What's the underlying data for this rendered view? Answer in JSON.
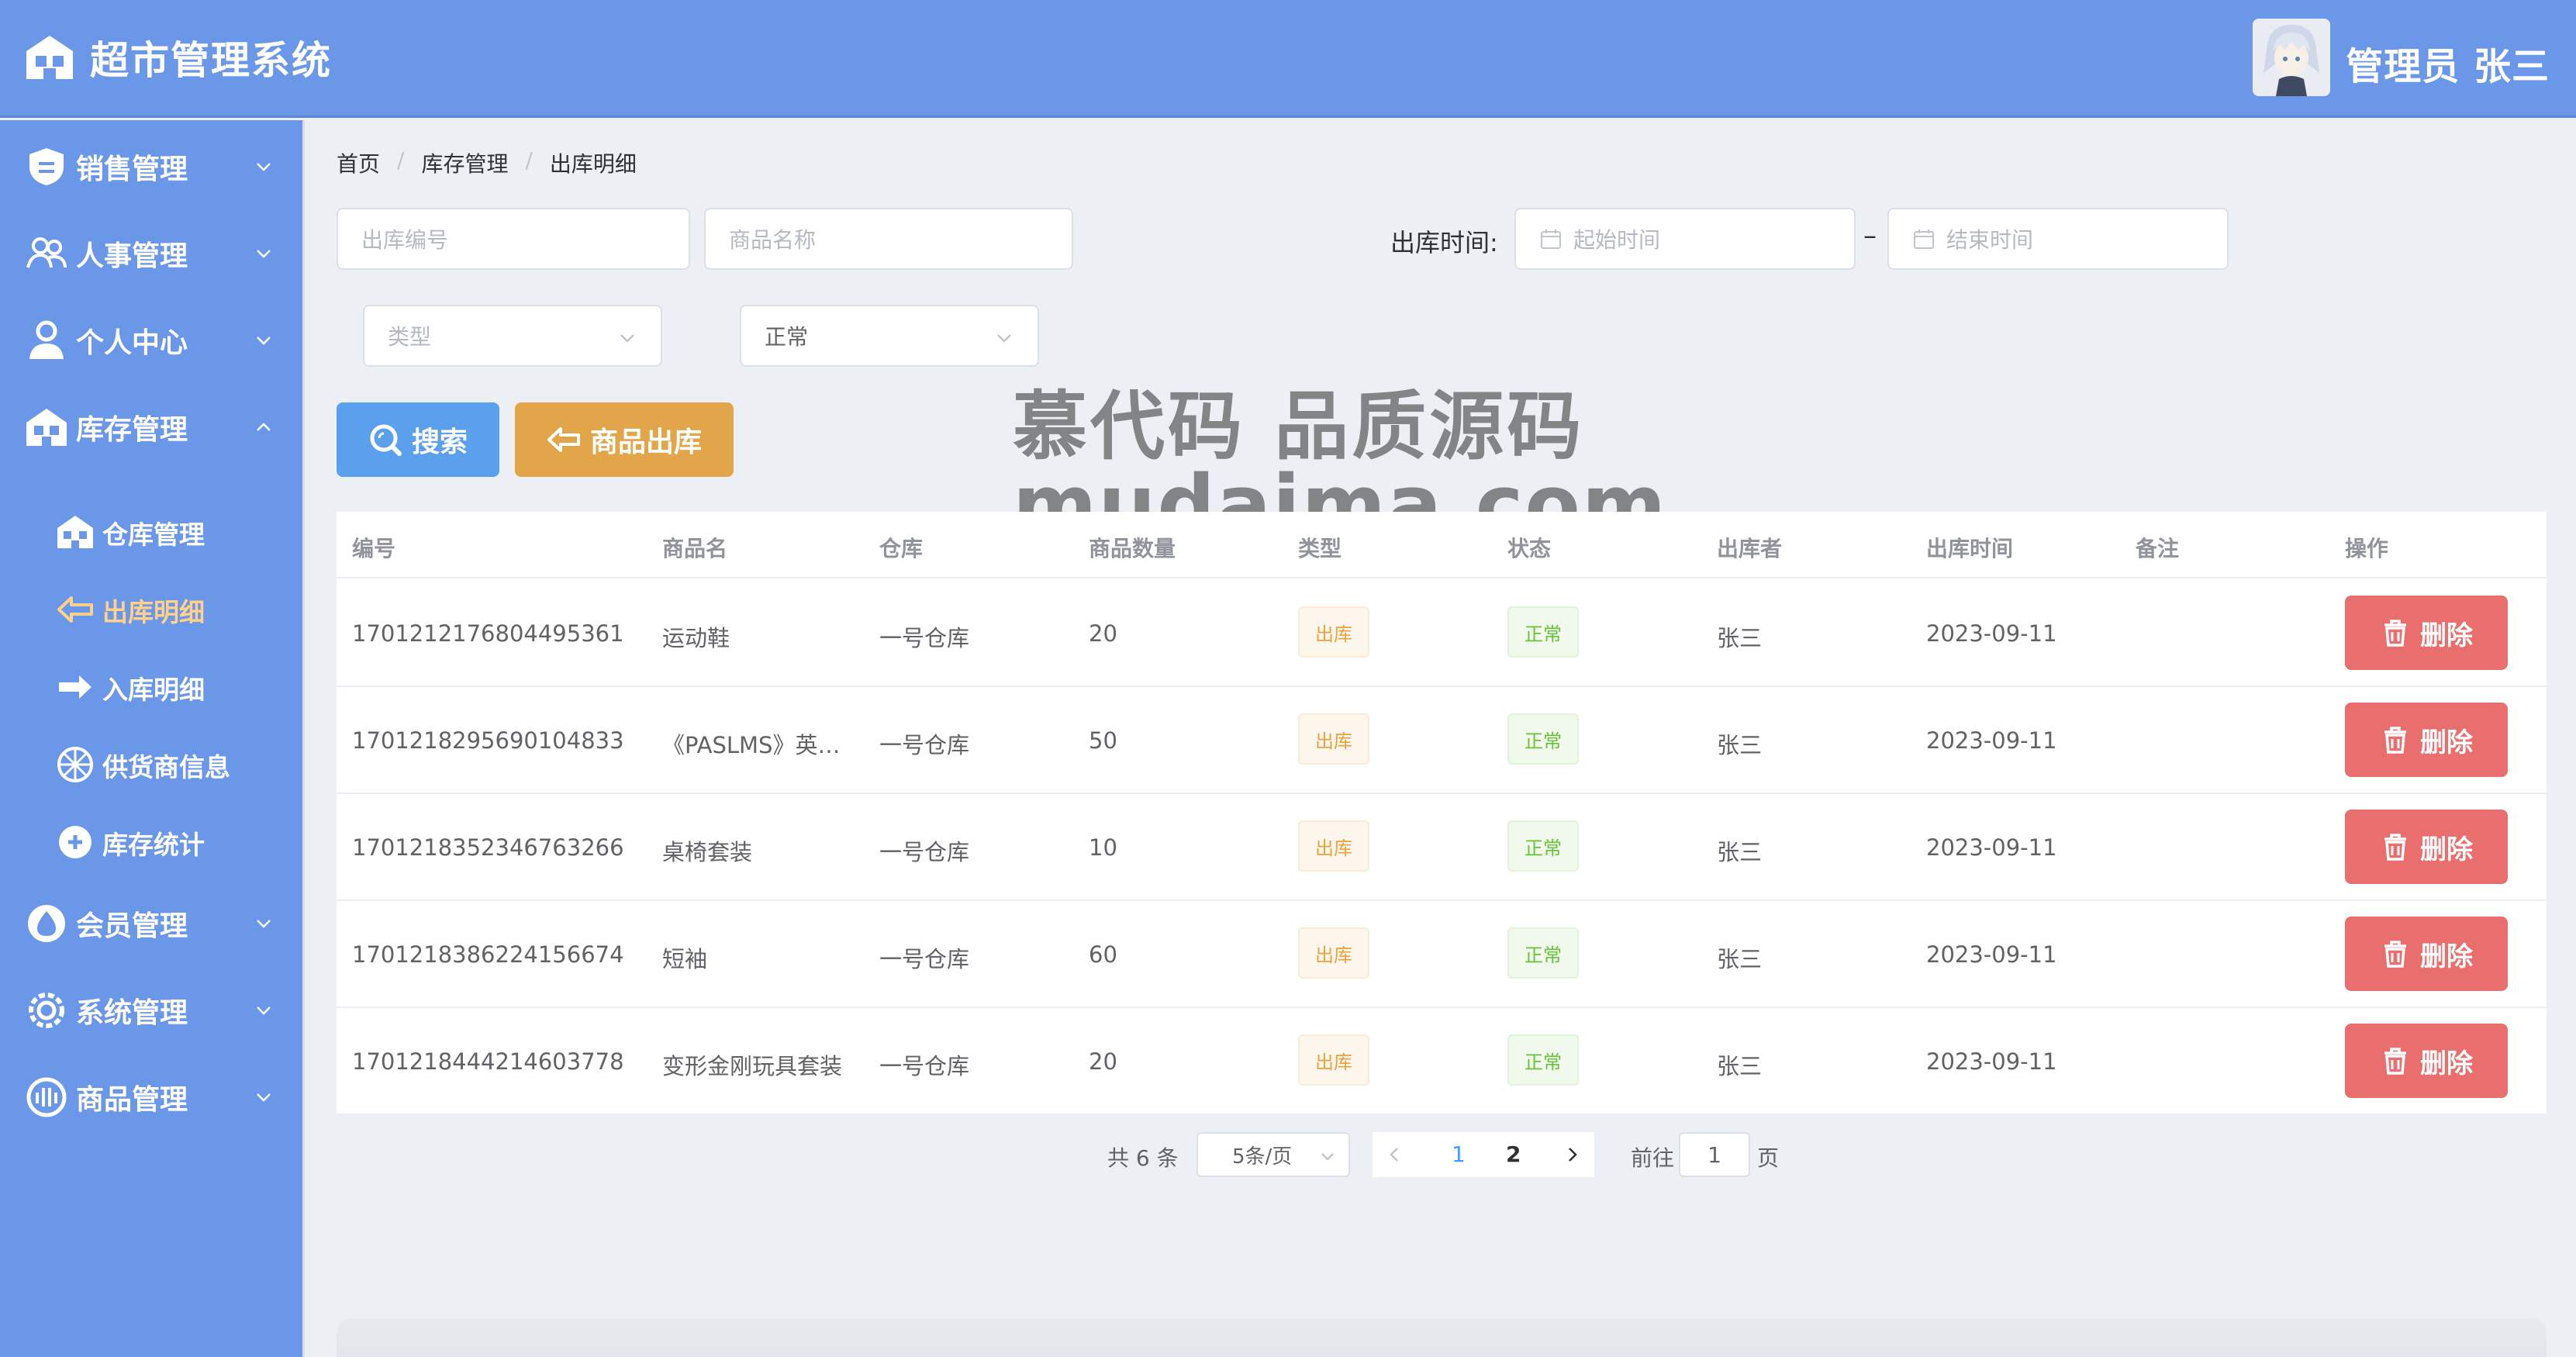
{
  "app": {
    "title": "超市管理系统",
    "user": "管理员 张三"
  },
  "sidebar": {
    "menus": [
      {
        "label": "销售管理",
        "icon": "sales-icon"
      },
      {
        "label": "人事管理",
        "icon": "staff-icon"
      },
      {
        "label": "个人中心",
        "icon": "person-icon"
      },
      {
        "label": "库存管理",
        "icon": "inventory-icon"
      },
      {
        "label": "会员管理",
        "icon": "member-icon"
      },
      {
        "label": "系统管理",
        "icon": "system-icon"
      },
      {
        "label": "商品管理",
        "icon": "goods-icon"
      }
    ],
    "submenus": [
      {
        "label": "仓库管理",
        "icon": "warehouse-icon"
      },
      {
        "label": "出库明细",
        "icon": "outbound-icon",
        "active": true
      },
      {
        "label": "入库明细",
        "icon": "inbound-icon"
      },
      {
        "label": "供货商信息",
        "icon": "supplier-icon"
      },
      {
        "label": "库存统计",
        "icon": "stats-icon"
      }
    ]
  },
  "breadcrumb": [
    "首页",
    "库存管理",
    "出库明细"
  ],
  "filters": {
    "out_no_placeholder": "出库编号",
    "goods_name_placeholder": "商品名称",
    "time_label": "出库时间:",
    "start_placeholder": "起始时间",
    "end_placeholder": "结束时间",
    "range_sep": "–",
    "type_placeholder": "类型",
    "status_value": "正常"
  },
  "buttons": {
    "search": "搜索",
    "outbound": "商品出库",
    "delete": "删除"
  },
  "watermark": {
    "line1": "慕代码 品质源码",
    "line2": "mudaima.com"
  },
  "table": {
    "headers": [
      "编号",
      "商品名",
      "仓库",
      "商品数量",
      "类型",
      "状态",
      "出库者",
      "出库时间",
      "备注",
      "操作"
    ],
    "rows": [
      {
        "id": "1701212176804495361",
        "name": "运动鞋",
        "warehouse": "一号仓库",
        "qty": "20",
        "type": "出库",
        "status": "正常",
        "operator": "张三",
        "time": "2023-09-11",
        "remark": ""
      },
      {
        "id": "1701218295690104833",
        "name": "《PASLMS》英…",
        "warehouse": "一号仓库",
        "qty": "50",
        "type": "出库",
        "status": "正常",
        "operator": "张三",
        "time": "2023-09-11",
        "remark": ""
      },
      {
        "id": "1701218352346763266",
        "name": "桌椅套装",
        "warehouse": "一号仓库",
        "qty": "10",
        "type": "出库",
        "status": "正常",
        "operator": "张三",
        "time": "2023-09-11",
        "remark": ""
      },
      {
        "id": "1701218386224156674",
        "name": "短袖",
        "warehouse": "一号仓库",
        "qty": "60",
        "type": "出库",
        "status": "正常",
        "operator": "张三",
        "time": "2023-09-11",
        "remark": ""
      },
      {
        "id": "1701218444214603778",
        "name": "变形金刚玩具套装",
        "warehouse": "一号仓库",
        "qty": "20",
        "type": "出库",
        "status": "正常",
        "operator": "张三",
        "time": "2023-09-11",
        "remark": ""
      }
    ]
  },
  "pagination": {
    "total": "共 6 条",
    "page_size": "5条/页",
    "pages": [
      "1",
      "2"
    ],
    "current": "1",
    "goto_label": "前往",
    "goto_value": "1",
    "page_suffix": "页"
  },
  "colors": {
    "primary": "#6a97e8",
    "warning": "#e2a54a",
    "danger": "#e96f6f",
    "search": "#5aa0ec"
  }
}
